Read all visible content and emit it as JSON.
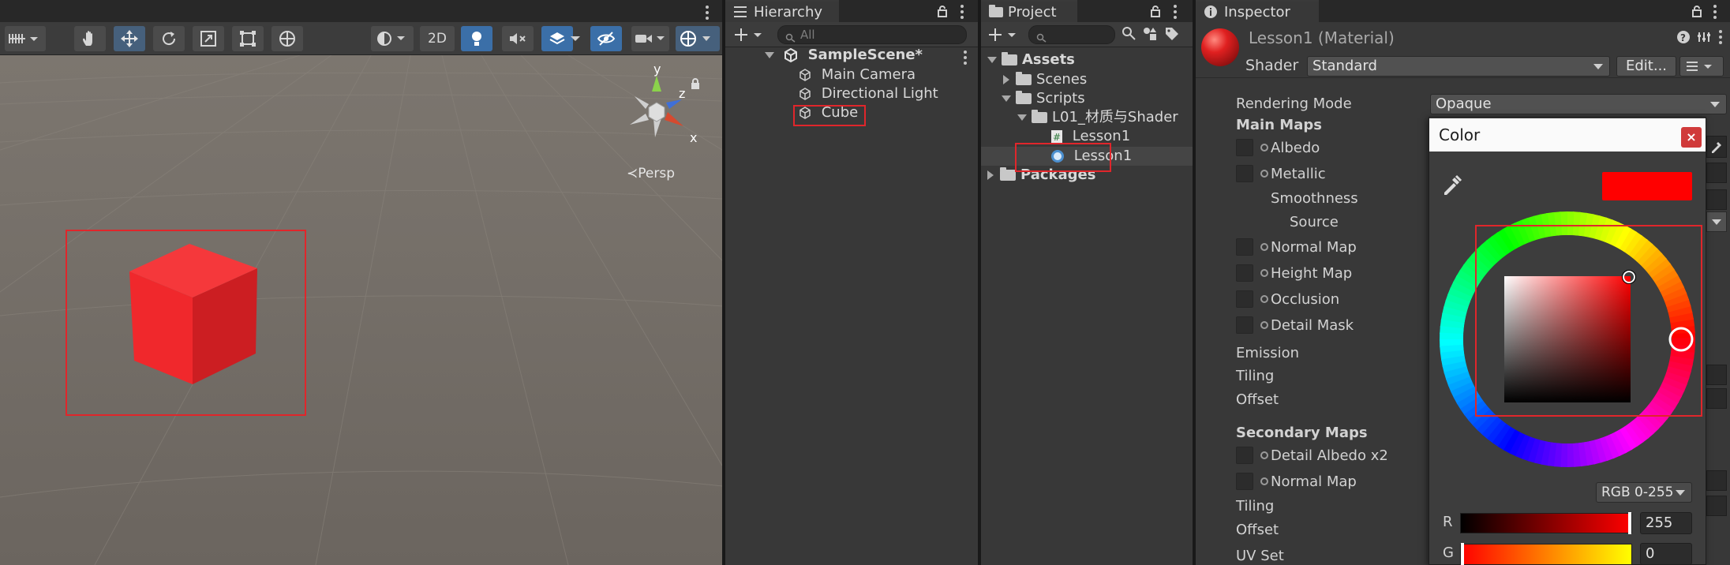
{
  "scene": {
    "toolbar": {
      "mode_2d": "2D"
    },
    "gizmo": {
      "axis_y": "y",
      "axis_z": "z",
      "axis_x": "x",
      "projection": "Persp"
    }
  },
  "hierarchy": {
    "tab": "Hierarchy",
    "search_placeholder": "All",
    "scene_name": "SampleScene*",
    "items": [
      "Main Camera",
      "Directional Light",
      "Cube"
    ]
  },
  "project": {
    "tab": "Project",
    "tree": {
      "assets": "Assets",
      "scenes": "Scenes",
      "scripts": "Scripts",
      "subfolder": "L01_材质与Shader",
      "script_file": "Lesson1",
      "material_file": "Lesson1",
      "packages": "Packages"
    }
  },
  "inspector": {
    "tab": "Inspector",
    "material_title": "Lesson1 (Material)",
    "shader_label": "Shader",
    "shader_value": "Standard",
    "edit_button": "Edit...",
    "rendering_mode_label": "Rendering Mode",
    "rendering_mode_value": "Opaque",
    "main_maps": "Main Maps",
    "albedo": "Albedo",
    "metallic": "Metallic",
    "smoothness": "Smoothness",
    "source": "Source",
    "normal_map": "Normal Map",
    "height_map": "Height Map",
    "occlusion": "Occlusion",
    "detail_mask": "Detail Mask",
    "emission": "Emission",
    "tiling": "Tiling",
    "offset": "Offset",
    "secondary_maps": "Secondary Maps",
    "detail_albedo": "Detail Albedo x2",
    "secondary_normal_map": "Normal Map",
    "secondary_tiling": "Tiling",
    "secondary_offset": "Offset",
    "uv_set": "UV Set"
  },
  "color_picker": {
    "title": "Color",
    "close": "×",
    "current_color": "#ff0000",
    "mode": "RGB 0-255",
    "r_label": "R",
    "r_value": "255",
    "g_label": "G",
    "g_value": "0"
  },
  "colors": {
    "highlight_box": "#e0262b",
    "cube_front": "#f0282c",
    "accent_blue": "#46607c"
  }
}
